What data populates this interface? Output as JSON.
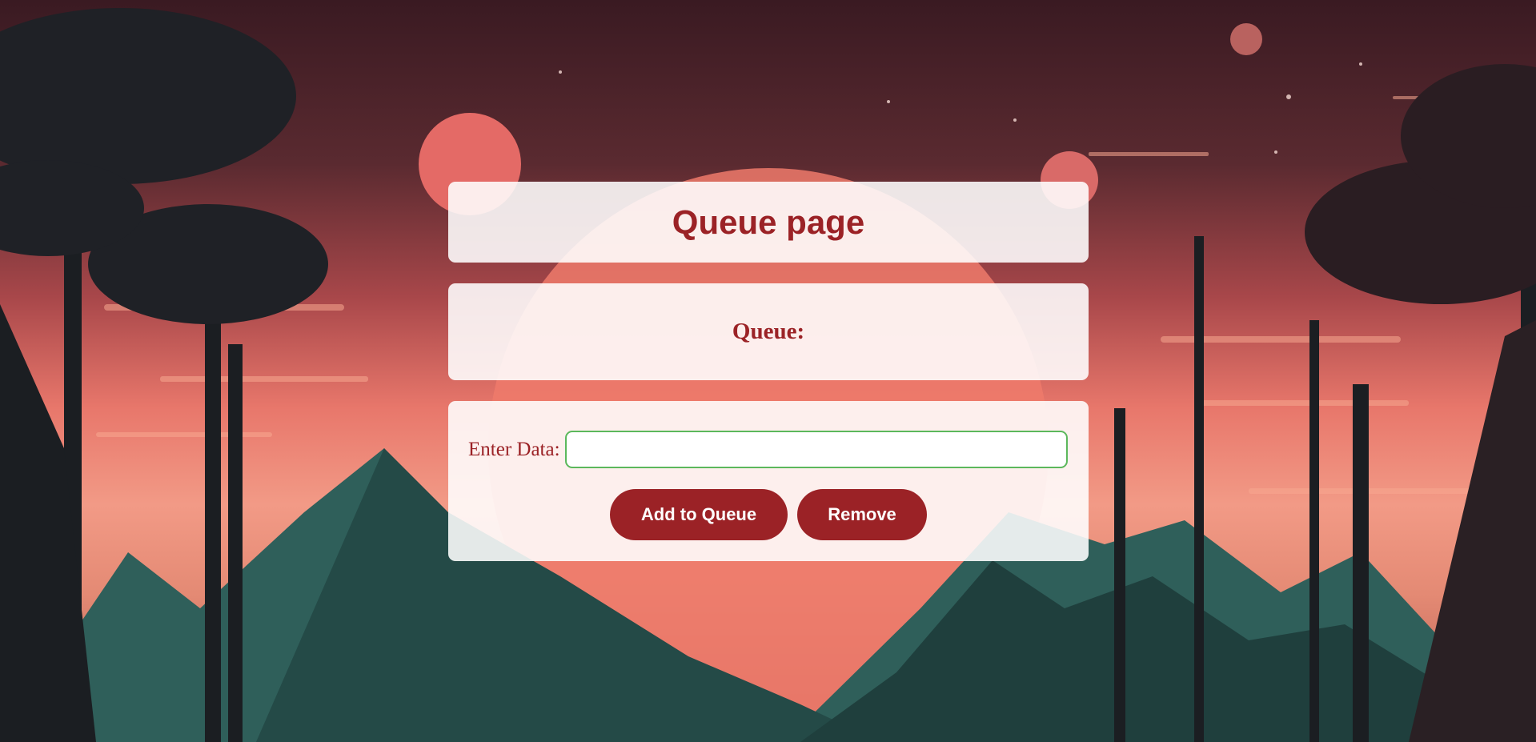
{
  "header": {
    "title": "Queue page"
  },
  "queue": {
    "label": "Queue:"
  },
  "form": {
    "input_label": "Enter Data:",
    "input_value": "",
    "add_button": "Add to Queue",
    "remove_button": "Remove"
  },
  "colors": {
    "accent": "#9b2226",
    "input_border": "#5cb85c",
    "panel": "#ffffff"
  },
  "background": {
    "icon": "sunset-mountain-landscape"
  }
}
